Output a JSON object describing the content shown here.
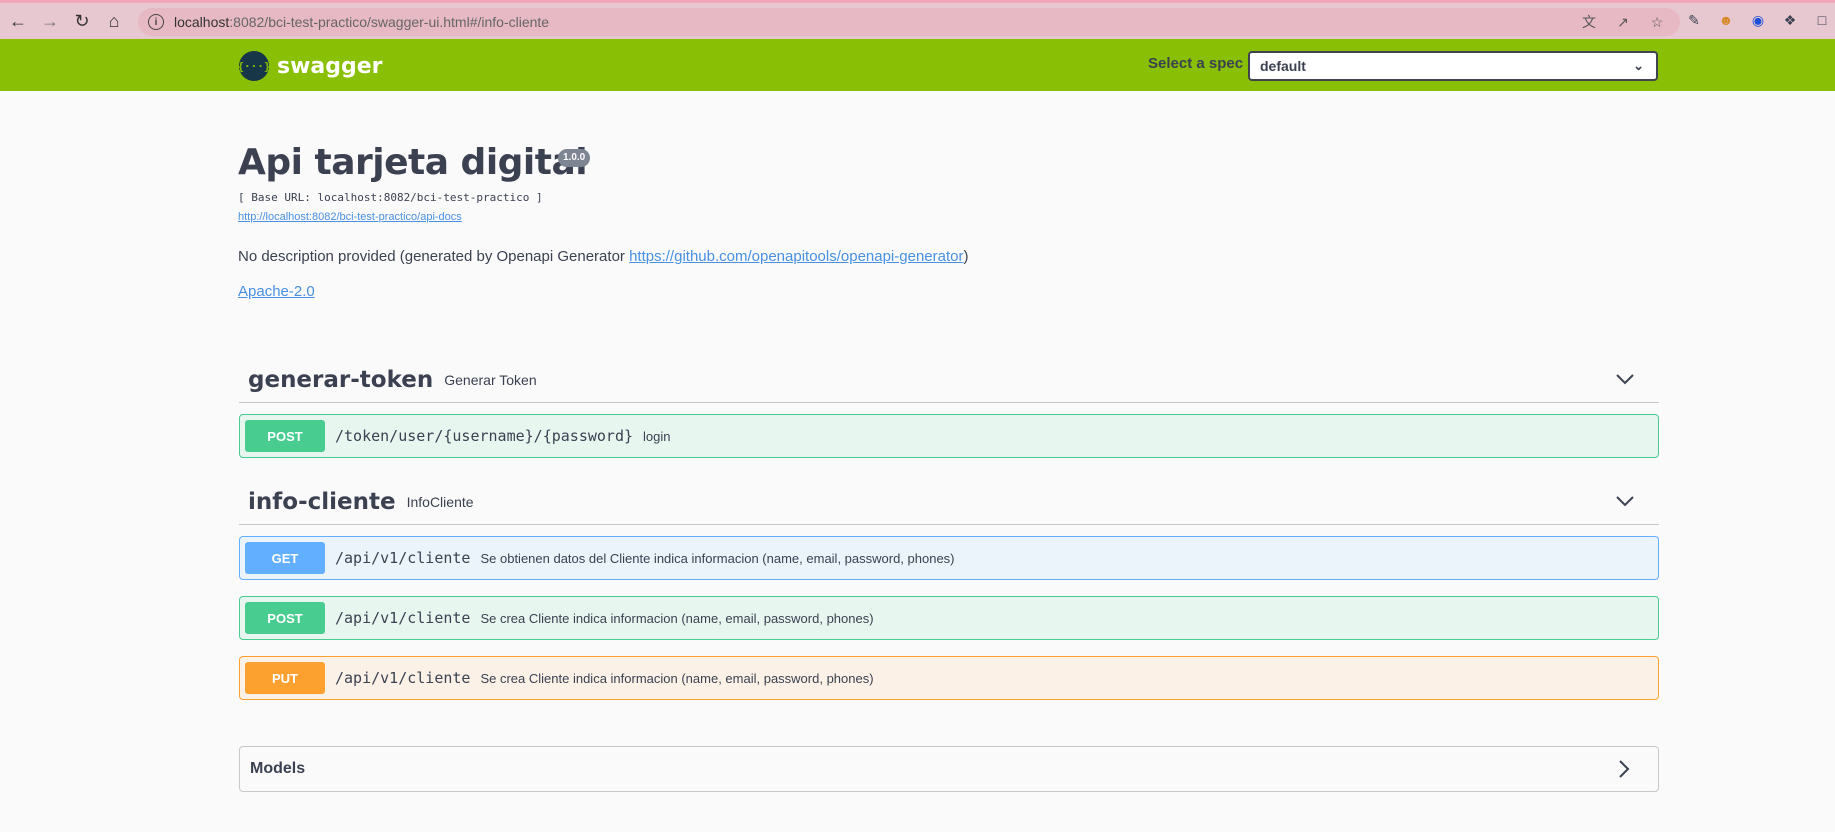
{
  "browser": {
    "url_host": "localhost",
    "url_rest": ":8082/bci-test-practico/swagger-ui.html#/info-cliente",
    "icons": [
      "back-icon",
      "forward-icon",
      "reload-icon",
      "home-icon",
      "info-icon",
      "translate-icon",
      "share-icon",
      "star-icon",
      "eyedropper-icon",
      "extension-avatar-icon",
      "extension-blue-icon",
      "puzzle-icon",
      "sidebar-icon"
    ]
  },
  "topbar": {
    "logo_glyph": "{···}",
    "logo_text": "swagger",
    "spec_label": "Select a spec",
    "spec_value": "default"
  },
  "info": {
    "title": "Api tarjeta digital",
    "version": "1.0.0",
    "base_url": "[ Base URL: localhost:8082/bci-test-practico ]",
    "docs_link": "http://localhost:8082/bci-test-practico/api-docs",
    "description_text": "No description provided (generated by Openapi Generator ",
    "description_link": "https://github.com/openapitools/openapi-generator",
    "description_end": ")",
    "license": "Apache-2.0"
  },
  "tags": [
    {
      "name": "generar-token",
      "description": "Generar Token",
      "operations": [
        {
          "method": "POST",
          "path": "/token/user/{username}/{password}",
          "summary": "login"
        }
      ]
    },
    {
      "name": "info-cliente",
      "description": "InfoCliente",
      "operations": [
        {
          "method": "GET",
          "path": "/api/v1/cliente",
          "summary": "Se obtienen datos del Cliente indica informacion (name, email, password, phones)"
        },
        {
          "method": "POST",
          "path": "/api/v1/cliente",
          "summary": "Se crea Cliente indica informacion (name, email, password, phones)"
        },
        {
          "method": "PUT",
          "path": "/api/v1/cliente",
          "summary": "Se crea Cliente indica informacion (name, email, password, phones)"
        }
      ]
    }
  ],
  "models": {
    "label": "Models"
  },
  "colors": {
    "topbar": "#89bf04",
    "post": "#49cc90",
    "get": "#61affe",
    "put": "#fca130",
    "link": "#4990e2"
  }
}
